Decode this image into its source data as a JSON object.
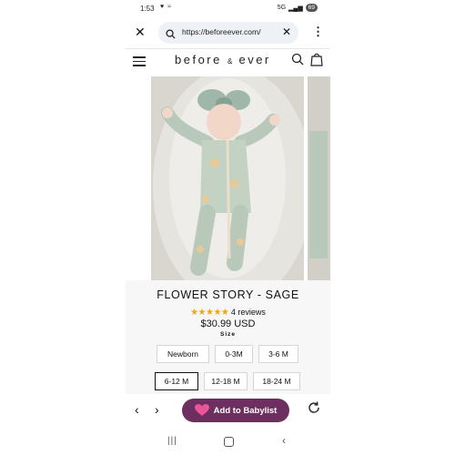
{
  "status_bar": {
    "time": "1:53",
    "signal": "5G",
    "battery": "69"
  },
  "browser": {
    "url": "https://beforeever.com/"
  },
  "site": {
    "logo_left": "before",
    "logo_amp": "&",
    "logo_right": "ever"
  },
  "product": {
    "title": "FLOWER STORY - SAGE",
    "stars": "★★★★★",
    "reviews": "4 reviews",
    "rating": 5,
    "price": "$30.99 USD",
    "size_label": "Size",
    "sizes": [
      "Newborn",
      "0-3M",
      "3-6 M",
      "6-12 M",
      "12-18 M",
      "18-24 M"
    ],
    "selected_size": "6-12 M"
  },
  "toolbar": {
    "babylist_label": "Add to Babylist"
  },
  "colors": {
    "babylist": "#6d2e60",
    "stars": "#f0a90c",
    "heart": "#e9559b"
  }
}
